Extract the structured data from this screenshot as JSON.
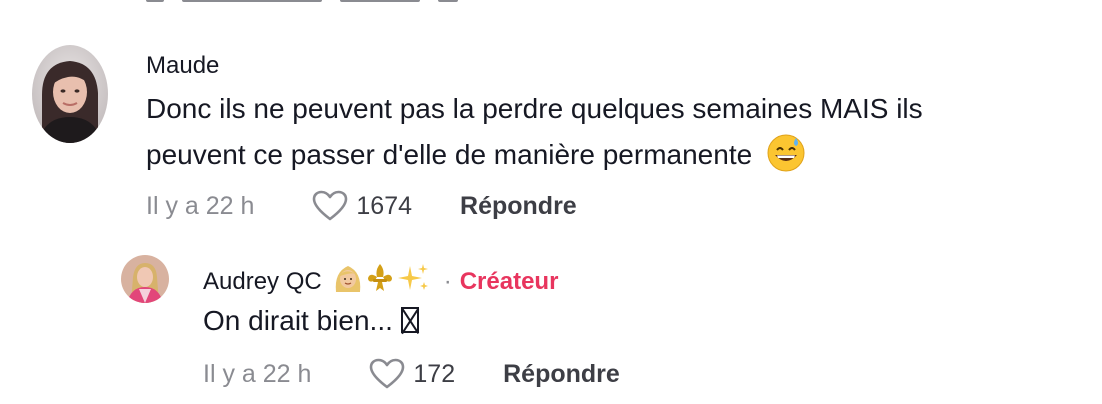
{
  "comment": {
    "username": "Maude",
    "text_line1": "Donc ils ne peuvent pas la perdre quelques semaines MAIS ils",
    "text_line2": "peuvent ce passer d'elle de manière permanente",
    "emoji_icon": "grinning-sweat-emoji",
    "time": "Il y a 22 h",
    "likes": "1674",
    "reply_label": "Répondre"
  },
  "reply": {
    "username": "Audrey QC",
    "name_emoji_icons": [
      "woman-blond-emoji",
      "fleur-de-lis-emoji",
      "sparkles-emoji"
    ],
    "separator": "·",
    "creator_label": "Créateur",
    "text": "On dirait bien...",
    "missing_glyph_icon": "missing-glyph-box",
    "time": "Il y a 22 h",
    "likes": "172",
    "reply_label": "Répondre"
  },
  "colors": {
    "text": "#161823",
    "muted": "#8a8b91",
    "creator": "#e8355e",
    "reply_button": "#3d3e45"
  }
}
